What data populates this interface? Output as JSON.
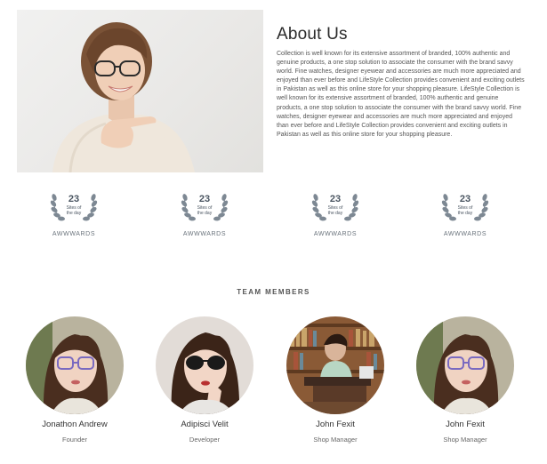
{
  "about": {
    "title": "About Us",
    "body": "Collection is well known for its extensive assortment of branded, 100% authentic and genuine products, a one stop solution to associate the consumer with the brand savvy world. Fine watches, designer eyewear and accessories are much more appreciated and enjoyed than ever before and LifeStyle Collection provides convenient and exciting outlets in Pakistan as well as this online store for your shopping pleasure. LifeStyle Collection is well known for its extensive assortment of branded, 100% authentic and genuine products, a one stop solution to associate the consumer with the brand savvy world. Fine watches, designer eyewear and accessories are much more appreciated and enjoyed than ever before and LifeStyle Collection provides convenient and exciting outlets in Pakistan as well as this online store for your shopping pleasure."
  },
  "awards": [
    {
      "number": "23",
      "subtitle_line1": "Sites of",
      "subtitle_line2": "the day",
      "label": "AWWWARDS"
    },
    {
      "number": "23",
      "subtitle_line1": "Sites of",
      "subtitle_line2": "the day",
      "label": "AWWWARDS"
    },
    {
      "number": "23",
      "subtitle_line1": "Sites of",
      "subtitle_line2": "the day",
      "label": "AWWWARDS"
    },
    {
      "number": "23",
      "subtitle_line1": "Sites of",
      "subtitle_line2": "the day",
      "label": "AWWWARDS"
    }
  ],
  "team": {
    "heading": "TEAM MEMBERS",
    "members": [
      {
        "name": "Jonathon Andrew",
        "role": "Founder"
      },
      {
        "name": "Adipisci Velit",
        "role": "Developer"
      },
      {
        "name": "John Fexit",
        "role": "Shop Manager"
      },
      {
        "name": "John Fexit",
        "role": "Shop Manager"
      }
    ]
  },
  "colors": {
    "award_laurel": "#7d8893",
    "text_dark": "#2b2b2b"
  }
}
